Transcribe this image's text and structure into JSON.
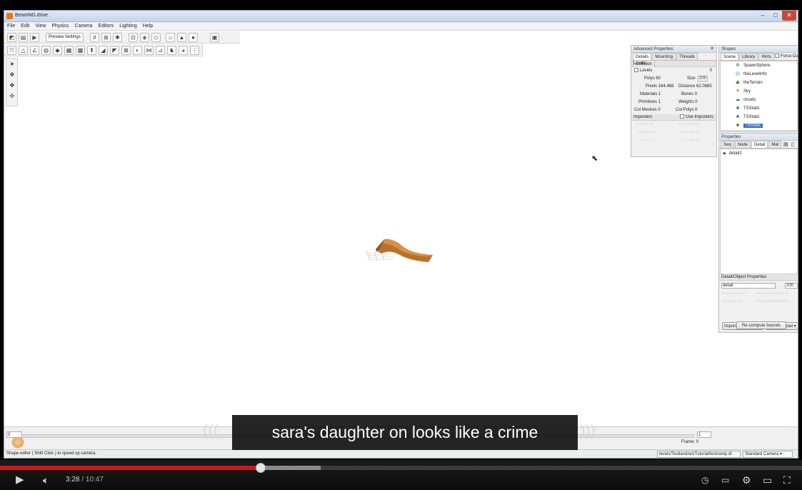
{
  "window": {
    "title": "BeamNG.drive"
  },
  "menu": [
    "File",
    "Edit",
    "View",
    "Physics",
    "Camera",
    "Editors",
    "Lighting",
    "Help"
  ],
  "toolbar": {
    "preview_settings": "Preview Settings"
  },
  "advanced_properties": {
    "title": "Advanced Properties",
    "tabs": [
      "Details",
      "Mounting",
      "Threads",
      "Collision"
    ],
    "levels_header": "Levels",
    "levels_label": "Levels",
    "levels_value": "0",
    "polys_label": "Polys 60",
    "size_label": "Size",
    "size_value": "200",
    "pixels_label": "Pixels 164.468",
    "distance_label": "Distance 62.0885",
    "materials_label": "Materials 1",
    "bones_label": "Bones 0",
    "primitives_label": "Primitives 1",
    "weights_label": "Weights 0",
    "col_meshes_label": "Col Meshes 0",
    "col_polys_label": "Col Polys 0",
    "imposters_header": "Imposters",
    "use_imposters": "Use Imposters"
  },
  "shapes": {
    "title": "Shapes",
    "tabs": [
      "Scene",
      "Library",
      "Hints"
    ],
    "force_label": "Force Da",
    "items": [
      "SpawnSphere",
      "theLevelInfo",
      "theTerrain",
      "Sky",
      "clouds",
      "TSStatic",
      "TSStatic",
      "TSStatic"
    ]
  },
  "properties": {
    "title": "Properties",
    "tabs": [
      "Seq",
      "Node",
      "Detail",
      "Mat"
    ],
    "node": "detail2",
    "detail_object_header": "Detail/Object Properties",
    "detail_name": "detail",
    "detail_size": "200",
    "import_btn": "Import Shape into...",
    "current_detail": "current detail",
    "recompute_btn": "Re-compute bounds"
  },
  "timeline": {
    "left_value": "0",
    "right_value": "1",
    "frame_label": "Frame:",
    "frame_value": "0"
  },
  "status": {
    "message": "Shape editor ( Shift Click ) to speed up camera.",
    "path": "levels/Testland/art/Tutorial/kickramp.dt",
    "camera": "Standard Camera"
  },
  "video": {
    "caption": "sara's daughter on looks like a crime",
    "current_time": "3:28",
    "total_time": "10:47",
    "progress_fraction": 0.325,
    "buffered_fraction": 0.4
  }
}
